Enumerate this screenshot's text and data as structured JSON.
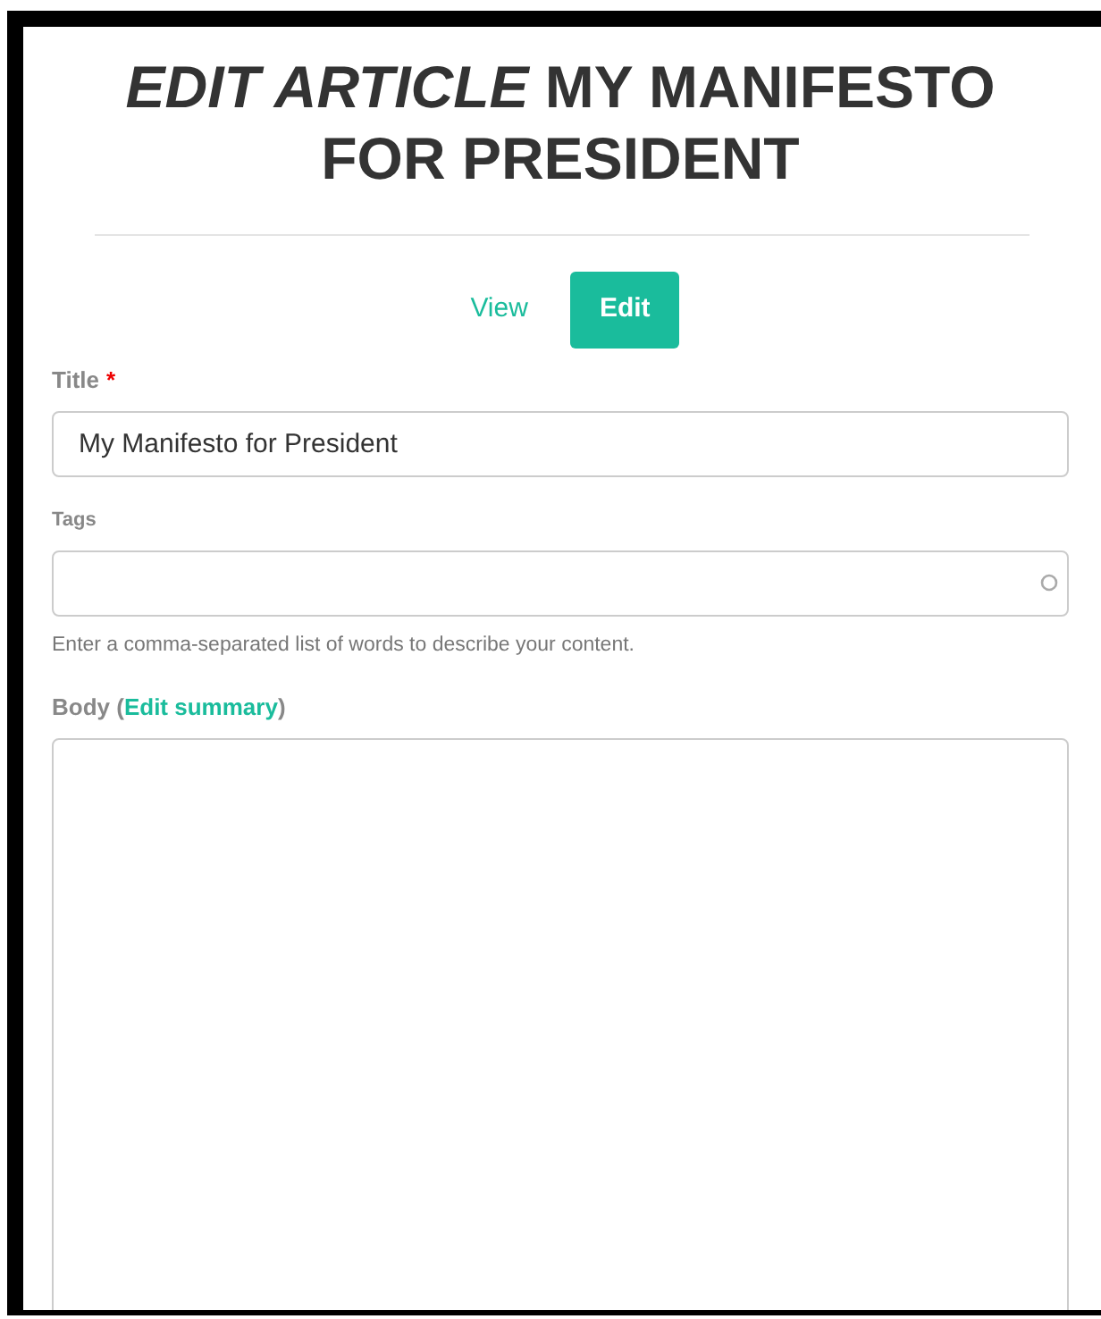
{
  "heading": "*EDIT ARTICLE* MY MANIFESTO FOR PRESIDENT",
  "tabs": [
    {
      "label": "View",
      "selected": false
    },
    {
      "label": "Edit",
      "selected": true
    }
  ],
  "fields": [
    {
      "kind": "text",
      "label": "Title",
      "required_mark": "*",
      "value": "My Manifesto for President"
    },
    {
      "kind": "tags",
      "label": "Tags",
      "description": "Enter a comma-separated list of words to describe your content."
    },
    {
      "kind": "body",
      "label": "Body (",
      "link": "Edit summary",
      "label_end": ")"
    }
  ]
}
